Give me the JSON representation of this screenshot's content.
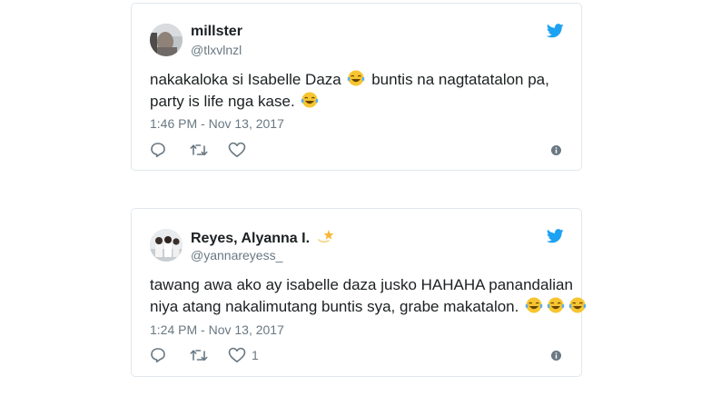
{
  "tweets": [
    {
      "name": "millster",
      "handle": "@tlxvlnzl",
      "text_line1_before": "nakakaloka si Isabelle Daza",
      "text_line1_after": "buntis na nagtatatalon pa,",
      "text_line2": "party is life nga kase.",
      "timestamp": "1:46 PM - Nov 13, 2017",
      "like_count": "",
      "emoji": "face-with-tears-of-joy"
    },
    {
      "name": "Reyes, Alyanna I.",
      "handle": "@yannareyess_",
      "text_line1": "tawang awa ako ay isabelle daza jusko HAHAHA panandalian",
      "text_line2": "niya atang nakalimutang buntis sya, grabe makatalon.",
      "timestamp": "1:24 PM - Nov 13, 2017",
      "like_count": "1",
      "emoji": "face-with-tears-of-joy"
    }
  ],
  "colors": {
    "twitter_blue": "#1da1f2",
    "text": "#1c2022",
    "muted": "#697882",
    "border": "#e1e8ed",
    "emoji_face": "#f7c531"
  },
  "icons": [
    "twitter-bird-icon",
    "reply-icon",
    "retweet-icon",
    "like-heart-icon",
    "info-icon",
    "dizzy-star-icon"
  ]
}
